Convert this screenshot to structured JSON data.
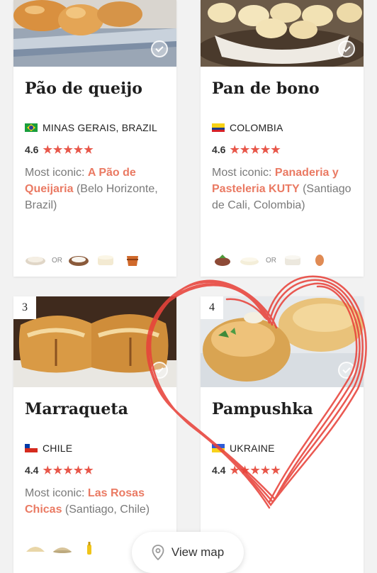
{
  "cards": [
    {
      "title": "Pão de queijo",
      "origin": "MINAS GERAIS, BRAZIL",
      "rating": "4.6",
      "stars": "★★★★★",
      "iconic_label": "Most iconic:",
      "iconic_place": "A Pão de Queijaria",
      "iconic_location": "(Belo Horizonte, Brazil)",
      "ingredient_or": "OR"
    },
    {
      "title": "Pan de bono",
      "origin": "COLOMBIA",
      "rating": "4.6",
      "stars": "★★★★★",
      "iconic_label": "Most iconic:",
      "iconic_place": "Panaderia y Pasteleria KUTY",
      "iconic_location": "(Santiago de Cali, Colombia)",
      "ingredient_or": "OR"
    },
    {
      "rank": "3",
      "title": "Marraqueta",
      "origin": "CHILE",
      "rating": "4.4",
      "stars": "★★★★★",
      "iconic_label": "Most iconic:",
      "iconic_place": "Las Rosas Chicas",
      "iconic_location": "(Santiago, Chile)"
    },
    {
      "rank": "4",
      "title": "Pampushka",
      "origin": "UKRAINE",
      "rating": "4.4",
      "stars": "★★★★★"
    }
  ],
  "view_map": {
    "label": "View map",
    "icon": "map-pin-icon"
  },
  "colors": {
    "accent": "#ea7a63",
    "stars": "#e8574a",
    "heart_doodle": "#e8433b"
  }
}
